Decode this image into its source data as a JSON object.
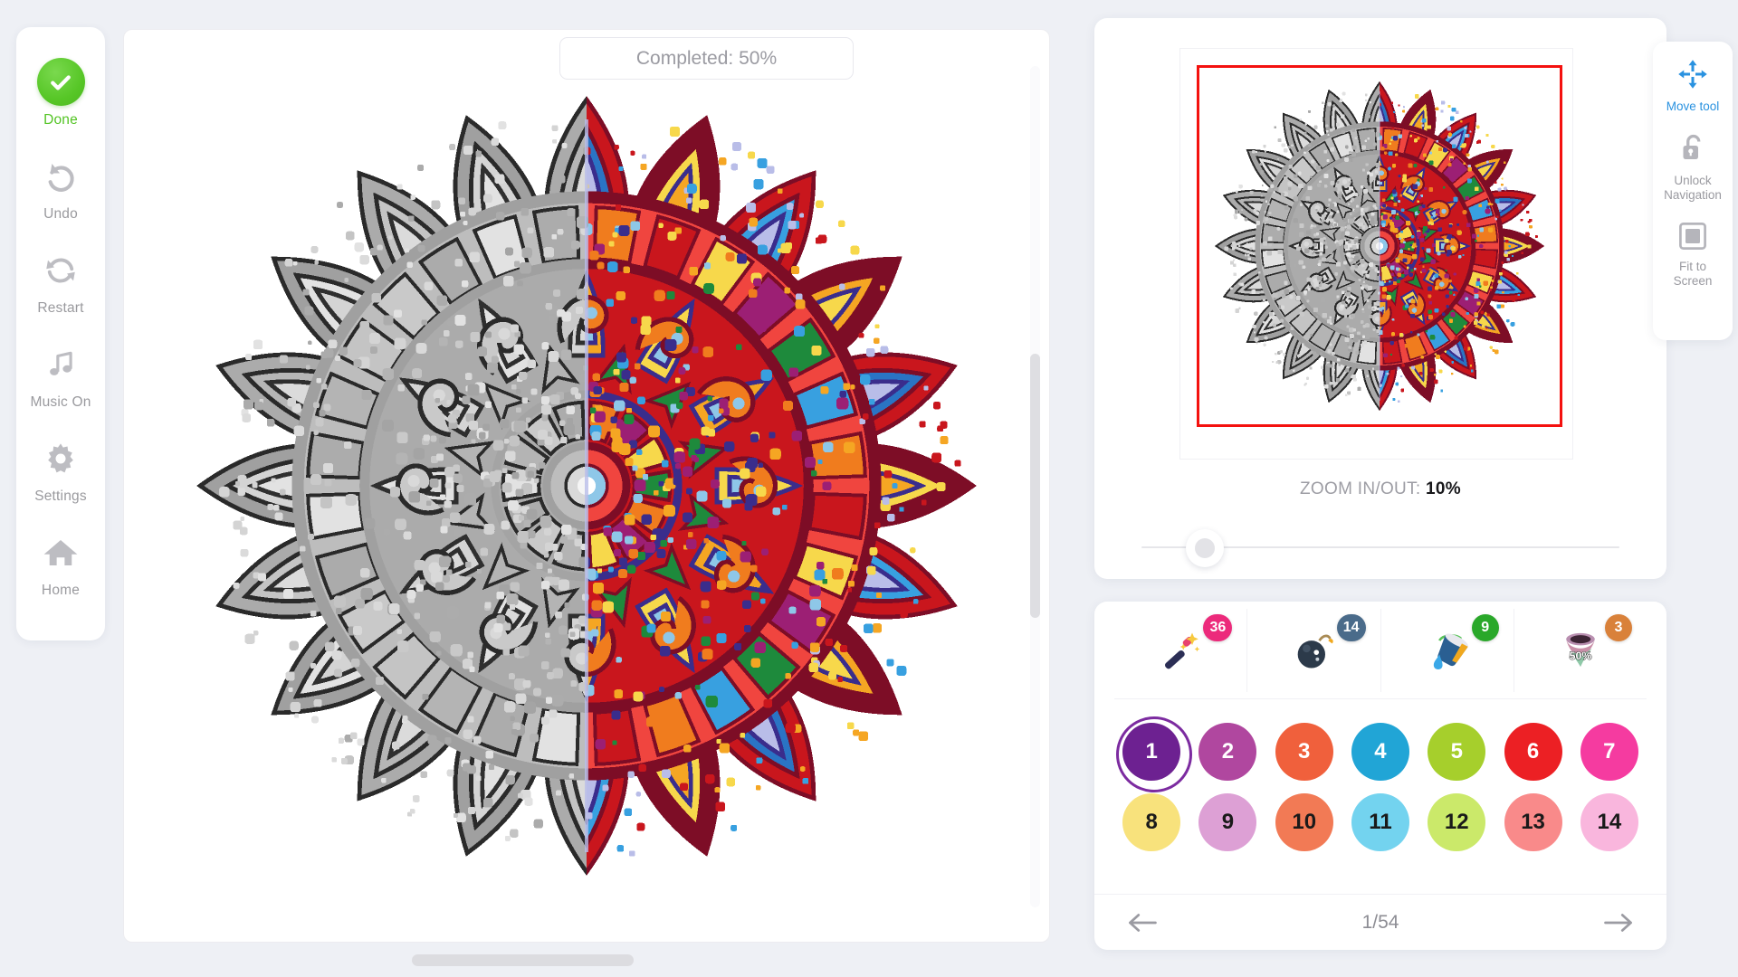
{
  "app": {
    "name": "mandala-coloring-by-number"
  },
  "header": {
    "completed_text": "Completed: 50%"
  },
  "sidebar": {
    "items": [
      {
        "label": "Done",
        "icon": "check-circle-icon",
        "active": true
      },
      {
        "label": "Undo",
        "icon": "undo-arrow-icon"
      },
      {
        "label": "Restart",
        "icon": "restart-circular-arrows-icon"
      },
      {
        "label": "Music On",
        "icon": "music-note-icon"
      },
      {
        "label": "Settings",
        "icon": "gear-icon"
      },
      {
        "label": "Home",
        "icon": "house-icon"
      }
    ]
  },
  "right_tools": {
    "items": [
      {
        "label": "Move tool",
        "icon": "move-arrows-icon",
        "active": true
      },
      {
        "label": "Unlock\nNavigation",
        "label_line1": "Unlock",
        "label_line2": "Navigation",
        "icon": "open-lock-icon"
      },
      {
        "label": "Fit to\nScreen",
        "label_line1": "Fit to",
        "label_line2": "Screen",
        "icon": "fit-square-icon"
      }
    ]
  },
  "minimap": {
    "viewport_border_color": "#f4110f",
    "zoom_prefix": "ZOOM IN/OUT:",
    "zoom_value": "10%",
    "slider_position_percent": 10
  },
  "powerups": [
    {
      "name": "magic-wand",
      "icon": "magic-wand-icon",
      "count": "36",
      "badge_color": "#ec2a7b"
    },
    {
      "name": "bomb",
      "icon": "bomb-icon",
      "count": "14",
      "badge_color": "#4a6b8a"
    },
    {
      "name": "paint-bucket",
      "icon": "paint-bucket-icon",
      "count": "9",
      "badge_color": "#2aa82a"
    },
    {
      "name": "tornado-50",
      "icon": "tornado-icon",
      "count": "3",
      "badge_color": "#d9813a",
      "overlay_text": "50%"
    }
  ],
  "palette": {
    "selected_index": 1,
    "selection_ring_color": "#7c2ba0",
    "swatches": [
      {
        "number": "1",
        "color": "#6d2191",
        "text_color": "#ffffff"
      },
      {
        "number": "2",
        "color": "#b0479f",
        "text_color": "#ffffff"
      },
      {
        "number": "3",
        "color": "#f0603c",
        "text_color": "#ffffff"
      },
      {
        "number": "4",
        "color": "#21a5d6",
        "text_color": "#ffffff"
      },
      {
        "number": "5",
        "color": "#a6cf2c",
        "text_color": "#ffffff"
      },
      {
        "number": "6",
        "color": "#ec2024",
        "text_color": "#ffffff"
      },
      {
        "number": "7",
        "color": "#f53ba0",
        "text_color": "#ffffff"
      },
      {
        "number": "8",
        "color": "#f8e27c",
        "text_color": "#1a1a1a"
      },
      {
        "number": "9",
        "color": "#dda0d5",
        "text_color": "#1a1a1a"
      },
      {
        "number": "10",
        "color": "#f27a55",
        "text_color": "#1a1a1a"
      },
      {
        "number": "11",
        "color": "#73d3ef",
        "text_color": "#1a1a1a"
      },
      {
        "number": "12",
        "color": "#cbe96a",
        "text_color": "#1a1a1a"
      },
      {
        "number": "13",
        "color": "#f98a8a",
        "text_color": "#1a1a1a"
      },
      {
        "number": "14",
        "color": "#f9b6dd",
        "text_color": "#1a1a1a"
      }
    ]
  },
  "pager": {
    "current": "1",
    "total": "54",
    "text": "1/54",
    "prev_icon": "arrow-left-icon",
    "next_icon": "arrow-right-icon"
  },
  "colors": {
    "page_background": "#eef0f5",
    "done_green": "#54c425",
    "accent_blue": "#2a92e0",
    "muted_text": "#9a9a9e"
  },
  "artwork": {
    "type": "mandala",
    "progress_percent": 50,
    "left_half_state": "uncolored-grayscale",
    "right_half_state": "colored",
    "palette_used": [
      "#c9161d",
      "#f0453f",
      "#7d0d26",
      "#f07c1e",
      "#f5a623",
      "#f7d84b",
      "#2a74c4",
      "#38a0e0",
      "#b9bde8",
      "#1e8a3c",
      "#9c1f74",
      "#3a2d8c",
      "#8ec7e8"
    ]
  }
}
